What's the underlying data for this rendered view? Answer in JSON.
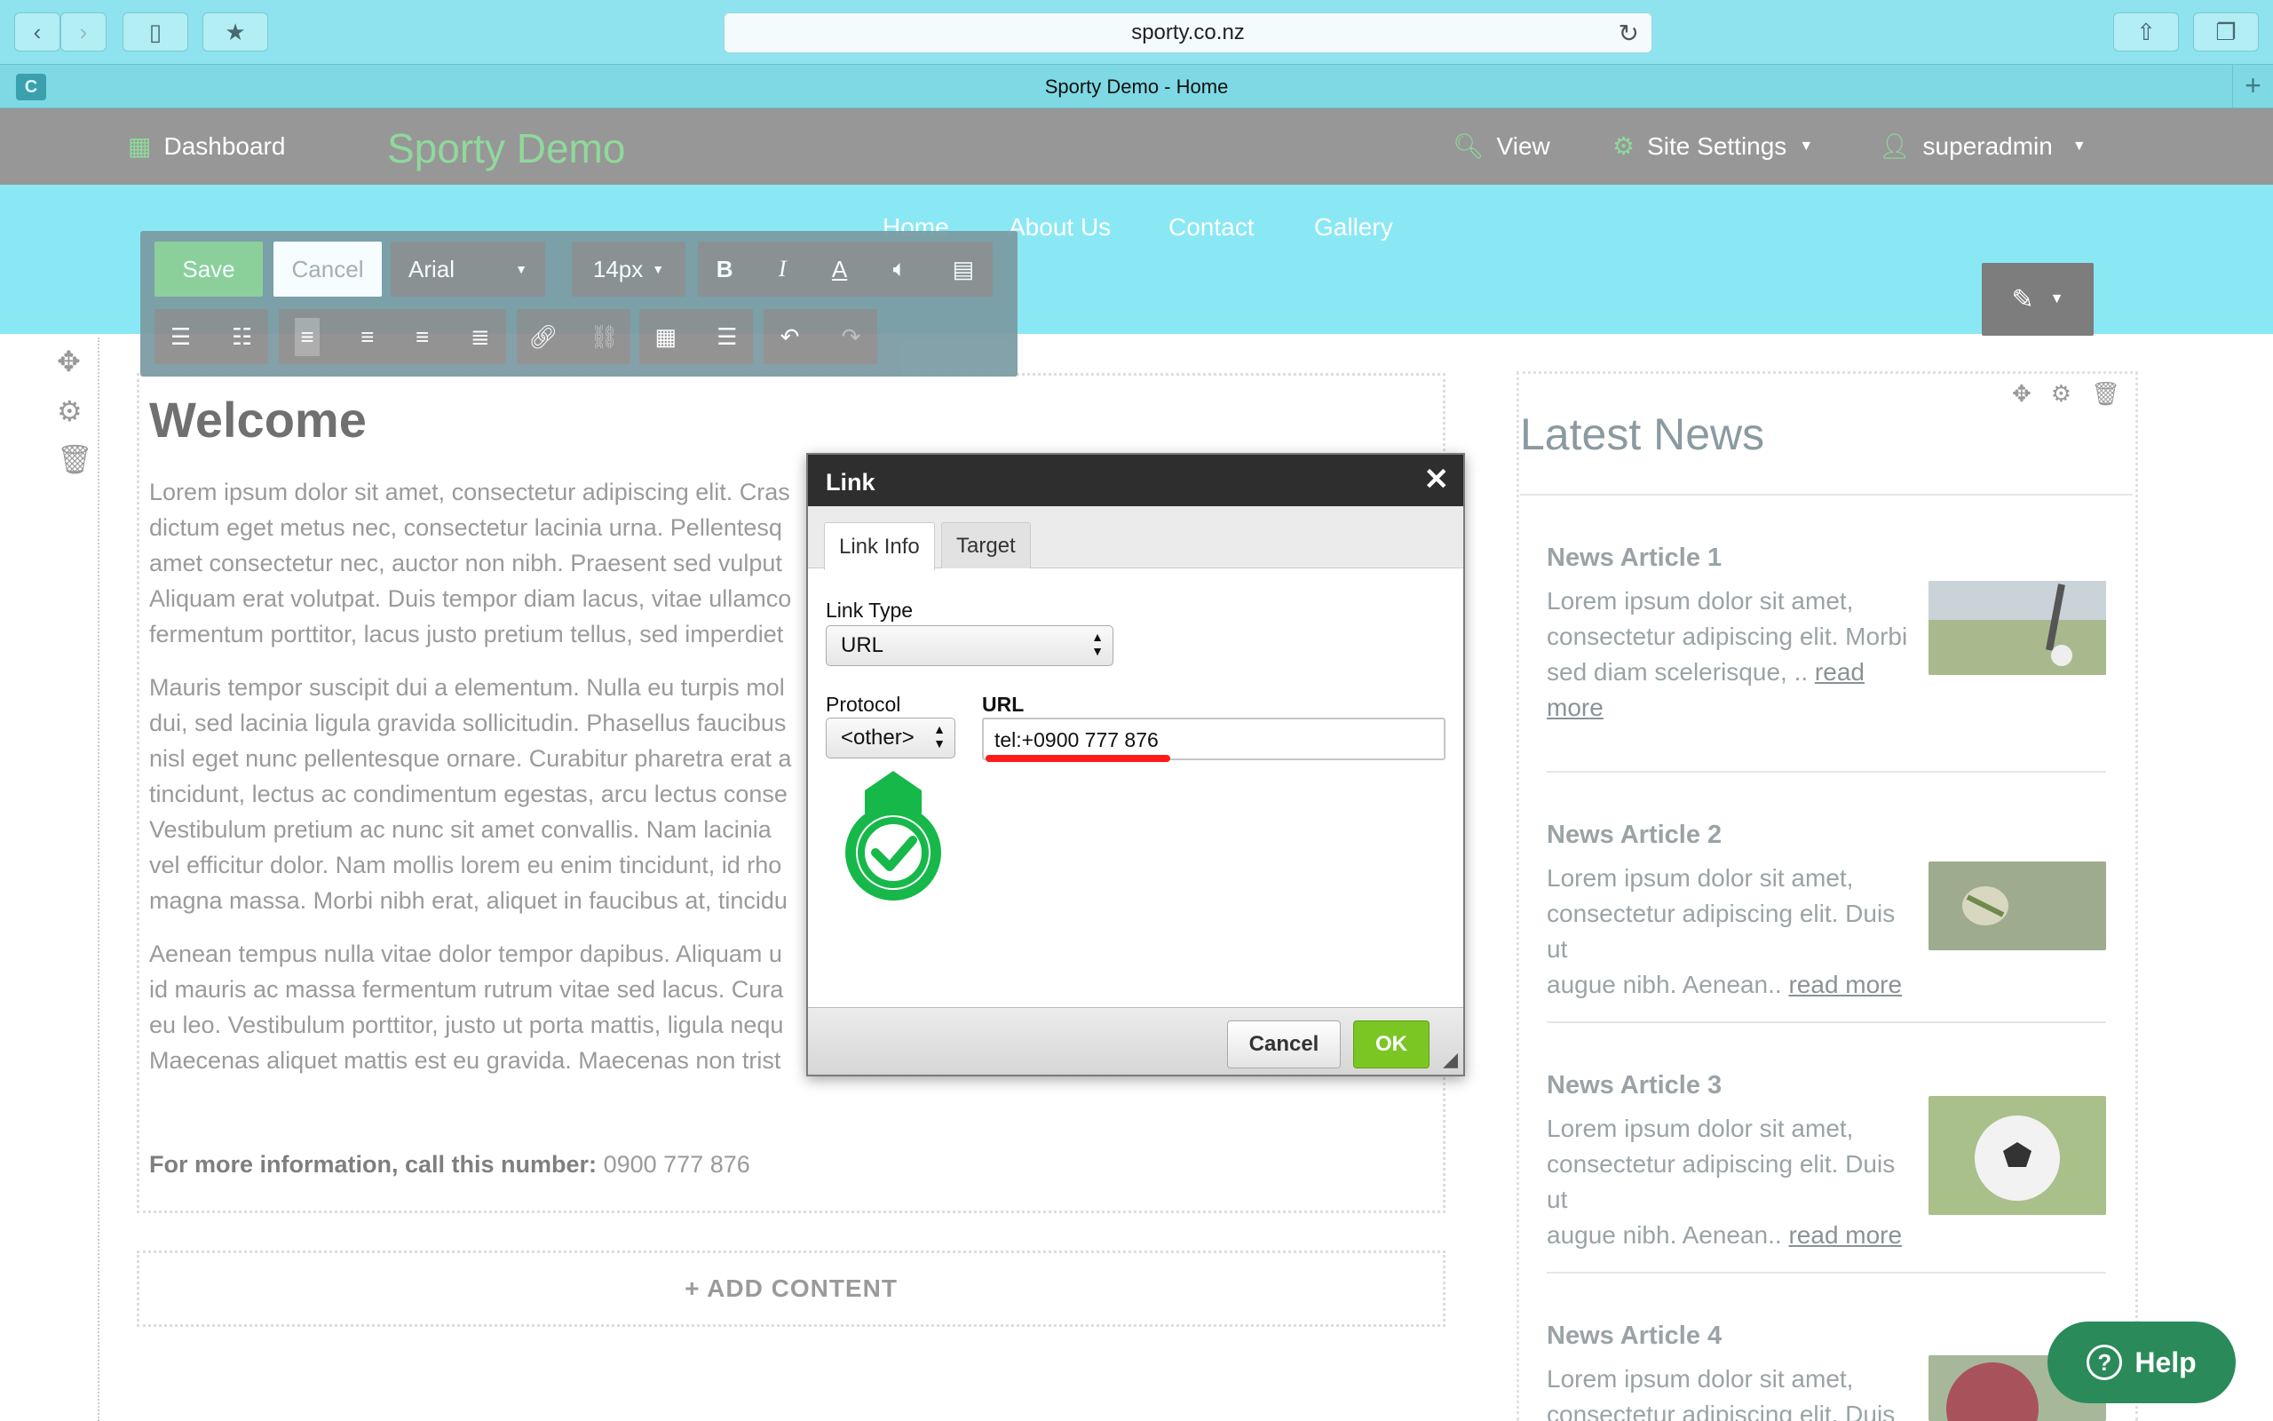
{
  "browser": {
    "url": "sporty.co.nz",
    "tab_title": "Sporty Demo - Home",
    "favicon_letter": "C"
  },
  "admin_bar": {
    "dashboard_label": "Dashboard",
    "brand": "Sporty Demo",
    "view_label": "View",
    "site_settings_label": "Site Settings",
    "user_label": "superadmin"
  },
  "site_nav": [
    "Home",
    "About Us",
    "Contact",
    "Gallery"
  ],
  "toolbar": {
    "save_label": "Save",
    "cancel_label": "Cancel",
    "font_family": "Arial",
    "font_size": "14px"
  },
  "welcome": {
    "title": "Welcome",
    "paragraphs": [
      [
        "Lorem ipsum dolor sit amet, consectetur adipiscing elit. Cras",
        "dictum eget metus nec, consectetur lacinia urna. Pellentesq",
        "amet consectetur nec, auctor non nibh. Praesent sed vulput",
        "Aliquam erat volutpat. Duis tempor diam lacus, vitae ullamco",
        "fermentum porttitor, lacus justo pretium tellus, sed imperdiet"
      ],
      [
        "Mauris tempor suscipit dui a elementum. Nulla eu turpis mol",
        "dui, sed lacinia ligula gravida sollicitudin. Phasellus faucibus",
        "nisl eget nunc pellentesque ornare. Curabitur pharetra erat a",
        "tincidunt, lectus ac condimentum egestas, arcu lectus conse",
        "Vestibulum pretium ac nunc sit amet convallis. Nam lacinia",
        "vel efficitur dolor. Nam mollis lorem eu enim tincidunt, id rho",
        "magna massa. Morbi nibh erat, aliquet in faucibus at, tincidu"
      ],
      [
        "Aenean tempus nulla vitae dolor tempor dapibus. Aliquam u",
        "id mauris ac massa fermentum rutrum vitae sed lacus. Cura",
        "eu leo. Vestibulum porttitor, justo ut porta mattis, ligula nequ",
        "Maecenas aliquet mattis est eu gravida. Maecenas non trist"
      ]
    ],
    "more_info_label": "For more information, call this number:",
    "more_info_number": "0900 777 876"
  },
  "add_content_label": "+ ADD CONTENT",
  "news": {
    "title": "Latest News",
    "articles": [
      {
        "title": "News Article 1",
        "lines": [
          "Lorem ipsum dolor sit amet,",
          "consectetur adipiscing elit. Morbi",
          "sed diam scelerisque, .. "
        ],
        "read": "read",
        "more": "more"
      },
      {
        "title": "News Article 2",
        "lines": [
          "Lorem ipsum dolor sit amet,",
          "consectetur adipiscing elit. Duis ut",
          "augue nibh. Aenean.. "
        ],
        "read_more": "read more"
      },
      {
        "title": "News Article 3",
        "lines": [
          "Lorem ipsum dolor sit amet,",
          "consectetur adipiscing elit. Duis ut",
          "augue nibh. Aenean.. "
        ],
        "read_more": "read more"
      },
      {
        "title": "News Article 4",
        "lines": [
          "Lorem ipsum dolor sit amet,",
          "consectetur adipiscing elit. Duis ut"
        ]
      }
    ]
  },
  "dialog": {
    "title": "Link",
    "tabs": [
      "Link Info",
      "Target"
    ],
    "link_type_label": "Link Type",
    "link_type_value": "URL",
    "protocol_label": "Protocol",
    "protocol_value": "<other>",
    "url_label": "URL",
    "url_value": "tel:+0900 777 876",
    "cancel_label": "Cancel",
    "ok_label": "OK"
  },
  "help_label": "Help",
  "colors": {
    "accent_green": "#7bc623",
    "header_cyan": "#8ae8f5",
    "admin_gray": "#979797",
    "highlight_red": "#ff1a1a",
    "check_green": "#17b84a"
  }
}
